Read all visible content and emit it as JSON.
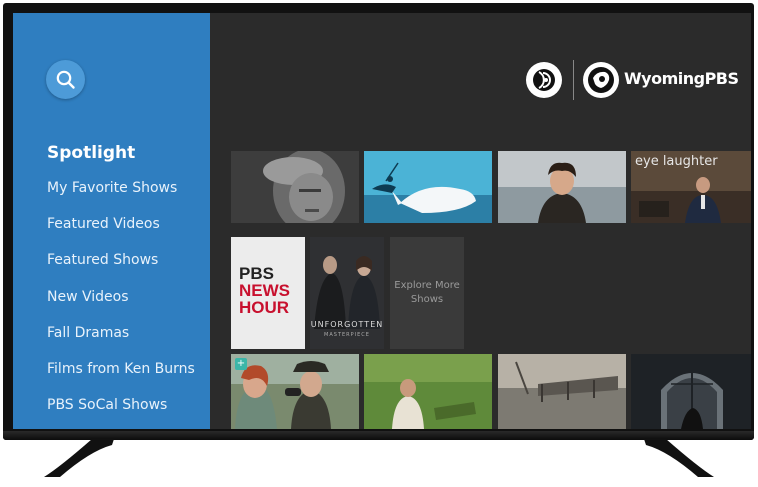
{
  "sidebar": {
    "search_icon": "search-icon",
    "items": [
      {
        "label": "Spotlight",
        "active": true
      },
      {
        "label": "My Favorite Shows"
      },
      {
        "label": "Featured Videos"
      },
      {
        "label": "Featured Shows"
      },
      {
        "label": "New Videos"
      },
      {
        "label": "Fall Dramas"
      },
      {
        "label": "Films from Ken Burns"
      },
      {
        "label": "PBS SoCal Shows"
      }
    ]
  },
  "brand": {
    "station_name": "WyomingPBS"
  },
  "rows": {
    "row1": [
      "portrait-tile",
      "whale-illustration-tile",
      "period-drama-tile",
      "eye-laughter-tile"
    ],
    "row1_tile4_text": "eye laughter",
    "row2": {
      "newshour_line1": "PBS",
      "newshour_line2": "NEWS",
      "newshour_line3": "HOUR",
      "unforgotten_title": "UNFORGOTTEN",
      "unforgotten_sub": "MASTERPIECE",
      "explore_label": "Explore More Shows"
    },
    "row3": [
      "binoculars-tile",
      "outdoor-scene-tile",
      "bridge-tile",
      "archway-tile"
    ],
    "row3_tile1_badge": "+"
  },
  "colors": {
    "sidebar_bg": "#2f7ec0",
    "screen_bg": "#2b2b2b",
    "newshour_red": "#c8102e"
  }
}
